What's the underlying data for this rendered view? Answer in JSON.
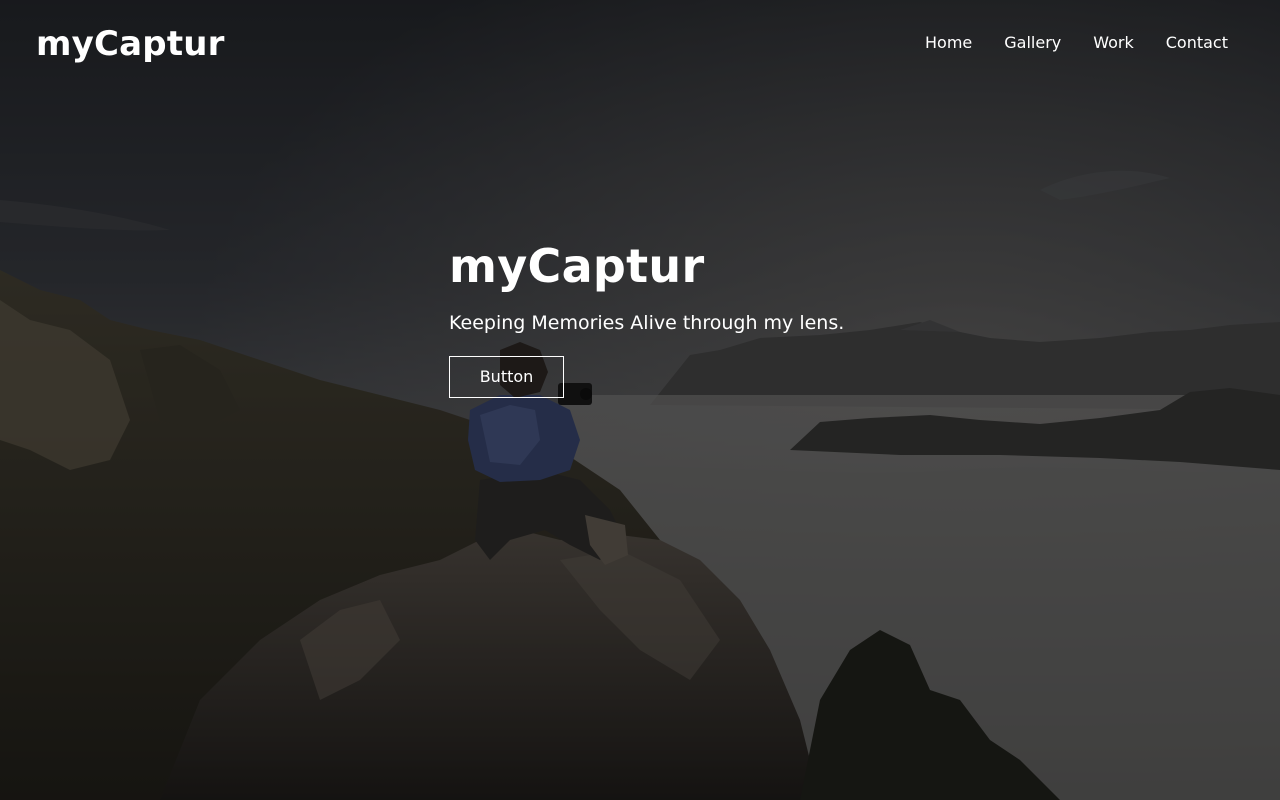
{
  "header": {
    "brand": "myCaptur",
    "nav": {
      "home": "Home",
      "gallery": "Gallery",
      "work": "Work",
      "contact": "Contact"
    }
  },
  "hero": {
    "title": "myCaptur",
    "subtitle": "Keeping Memories Alive through my lens.",
    "button_label": "Button"
  },
  "background": {
    "subject": "photographer-on-mountain-peak-image"
  },
  "colors": {
    "text": "#ffffff",
    "overlay": "#0a0a0c"
  }
}
